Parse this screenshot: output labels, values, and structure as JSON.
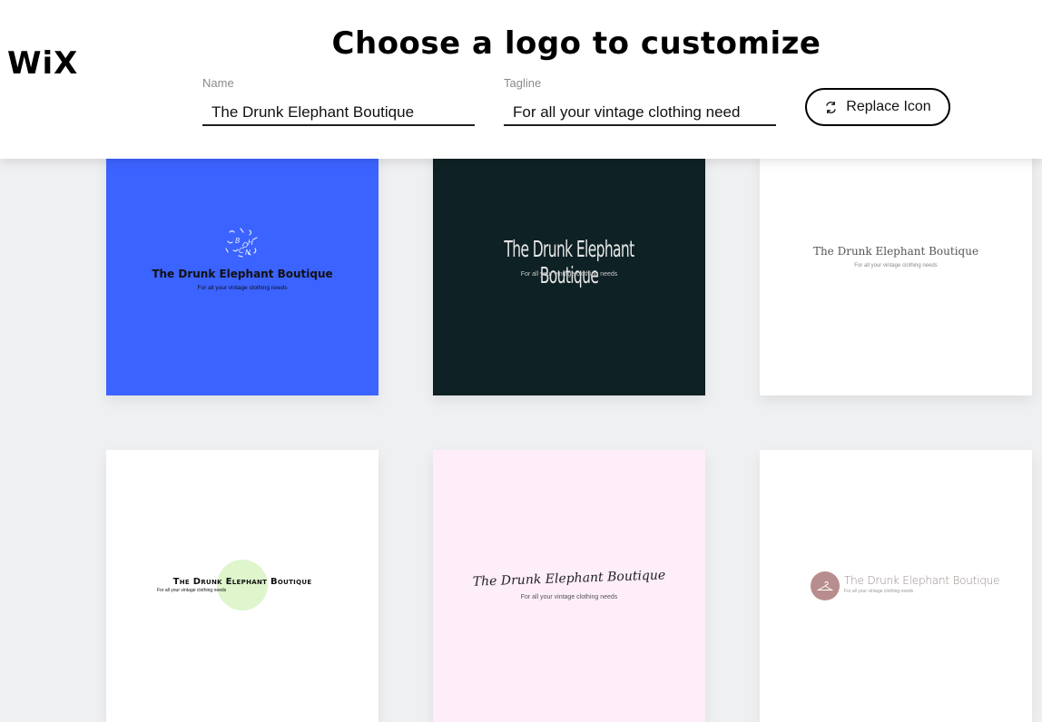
{
  "brand": {
    "logo_text": "WiX"
  },
  "page": {
    "title": "Choose a logo to customize"
  },
  "form": {
    "name_label": "Name",
    "name_value": "The Drunk Elephant Boutique",
    "tagline_label": "Tagline",
    "tagline_value": "For all your vintage clothing need",
    "replace_icon_label": "Replace Icon"
  },
  "logos": [
    {
      "name": "The Drunk Elephant Boutique",
      "tagline": "For all your vintage clothing needs",
      "background": "#3b63ff",
      "icon": "confetti-letters-icon"
    },
    {
      "name": "The Drunk Elephant Boutique",
      "tagline": "For all your vintage clothing needs",
      "background": "#0e2124",
      "icon": ""
    },
    {
      "name": "The Drunk Elephant Boutique",
      "tagline": "For all your vintage clothing needs",
      "background": "#ffffff",
      "icon": ""
    },
    {
      "name": "The Drunk Elephant Boutique",
      "tagline": "For all your vintage clothing needs",
      "background": "#ffffff",
      "icon": "green-circle-icon"
    },
    {
      "name": "The Drunk Elephant Boutique",
      "tagline": "For all your vintage clothing needs",
      "background": "#fdeefa",
      "icon": ""
    },
    {
      "name": "The Drunk Elephant Boutique",
      "tagline": "For all your vintage clothing needs",
      "background": "#ffffff",
      "icon": "hanger-icon"
    }
  ]
}
